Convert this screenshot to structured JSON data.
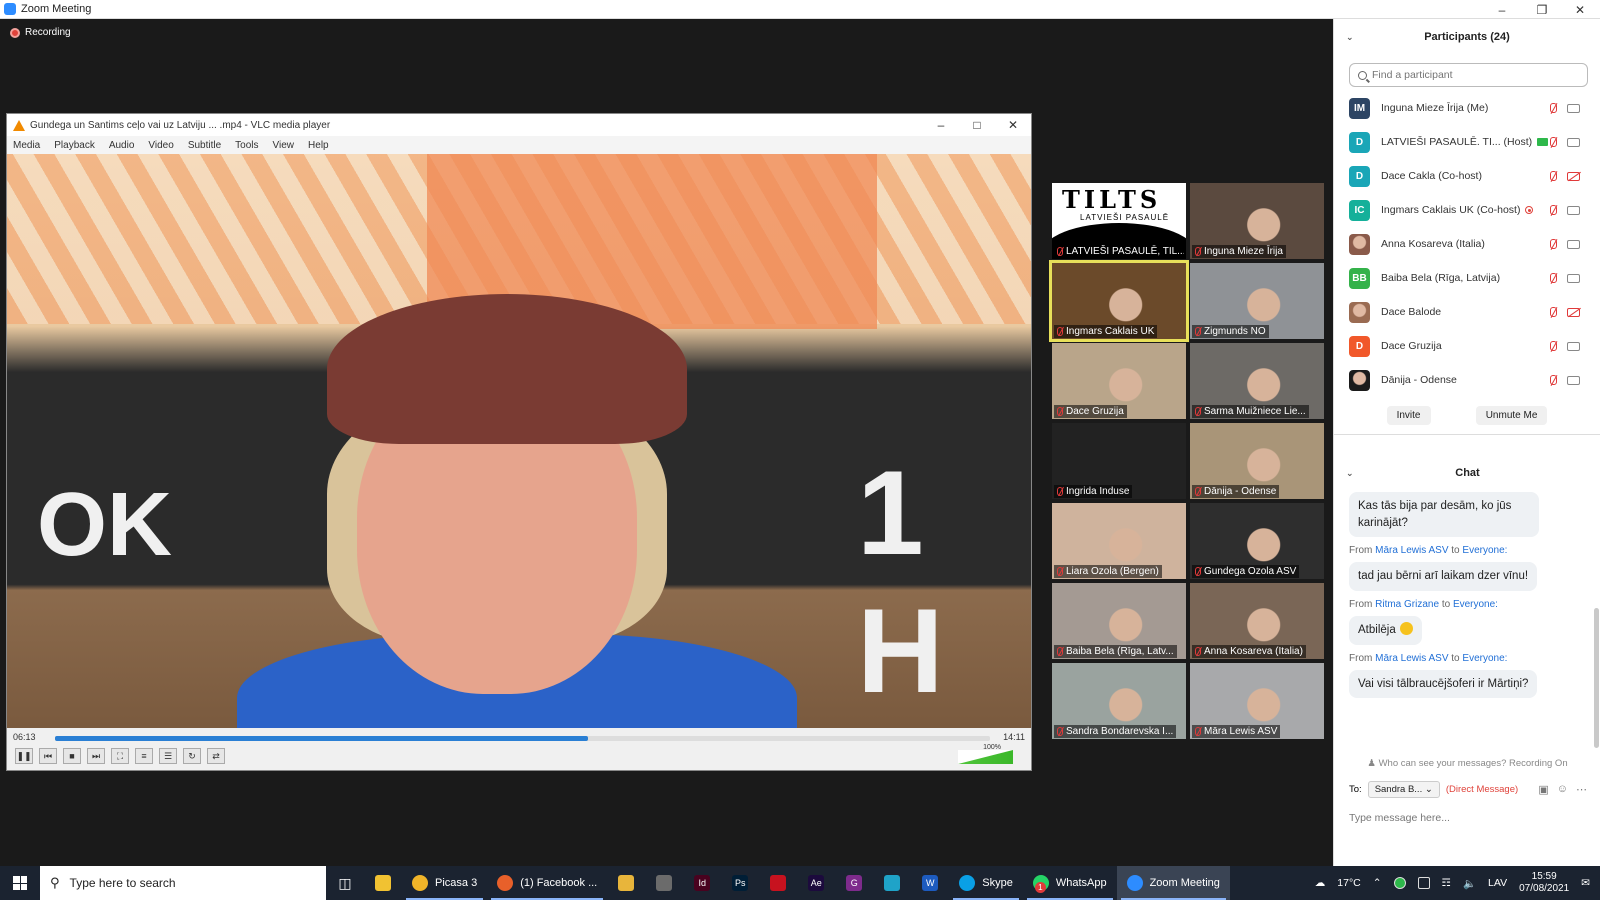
{
  "window": {
    "title": "Zoom Meeting"
  },
  "recording": {
    "label": "Recording"
  },
  "vlc": {
    "title": "Gundega un Santims ceļo vai uz Latviju ... .mp4 - VLC media player",
    "menu": [
      "Media",
      "Playback",
      "Audio",
      "Video",
      "Subtitle",
      "Tools",
      "View",
      "Help"
    ],
    "time_elapsed": "06:13",
    "time_total": "14:11",
    "progress": 0.57,
    "volume_label": "100%",
    "sign_left": "OK",
    "sign_right": "1 H"
  },
  "gallery": [
    {
      "name": "LATVIEŠI PASAULĒ, TIL...",
      "style": "tilts"
    },
    {
      "name": "Inguna Mieze Īrija",
      "color": "#5b4a3f"
    },
    {
      "name": "Ingmars Caklais UK",
      "color": "#6b4a2a",
      "active": true
    },
    {
      "name": "Zigmunds NO",
      "color": "#8f9296"
    },
    {
      "name": "Dace Gruzija",
      "color": "#b9a58a"
    },
    {
      "name": "Sarma Muižniece Lie...",
      "color": "#6d6a66"
    },
    {
      "name": "Ingrida Induse",
      "color": "#222222"
    },
    {
      "name": "Dānija - Odense",
      "color": "#a99578"
    },
    {
      "name": "Liara Ozola (Bergen)",
      "color": "#cfb39d"
    },
    {
      "name": "Gundega Ozola ASV",
      "color": "#2e2e2e"
    },
    {
      "name": "Baiba Bela (Rīga, Latv...",
      "color": "#a49a93"
    },
    {
      "name": "Anna Kosareva (Italia)",
      "color": "#7a6656"
    },
    {
      "name": "Sandra Bondarevska I...",
      "color": "#9aa39f"
    },
    {
      "name": "Māra Lewis ASV",
      "color": "#a8a9ab"
    }
  ],
  "tilts": {
    "title": "TILTS",
    "subtitle": "LATVIEŠI PASAULĒ"
  },
  "participants": {
    "header": "Participants (24)",
    "search_placeholder": "Find a participant",
    "list": [
      {
        "initials": "IM",
        "color": "#2d4564",
        "name": "Inguna Mieze Īrija (Me)",
        "cam_off": false
      },
      {
        "initials": "D",
        "color": "#1aa6b7",
        "name": "LATVIEŠI PASAULĒ. TI... (Host)",
        "share": true,
        "cam_off": false
      },
      {
        "initials": "D",
        "color": "#1aa6b7",
        "name": "Dace Cakla (Co-host)",
        "cam_off": true
      },
      {
        "initials": "IC",
        "color": "#15b09a",
        "name": "Ingmars Caklais UK (Co-host)",
        "rec": true,
        "cam_off": false
      },
      {
        "initials": "",
        "color": "#8a5a4a",
        "name": "Anna Kosareva (Italia)",
        "cam_off": false
      },
      {
        "initials": "BB",
        "color": "#34b24a",
        "name": "Baiba Bela (Rīga, Latvija)",
        "cam_off": false
      },
      {
        "initials": "",
        "color": "#9a6b52",
        "name": "Dace Balode",
        "cam_off": true
      },
      {
        "initials": "D",
        "color": "#f1582a",
        "name": "Dace Gruzija",
        "cam_off": false
      },
      {
        "initials": "",
        "color": "#1b1b1b",
        "name": "Dānija - Odense",
        "cam_off": false
      }
    ],
    "invite_label": "Invite",
    "unmute_label": "Unmute Me"
  },
  "chat": {
    "header": "Chat",
    "messages": [
      {
        "from": null,
        "text": "Kas tās bija par desām, ko jūs karinājāt?"
      },
      {
        "from": "Māra Lewis ASV",
        "to": "Everyone:",
        "text": "tad jau bērni arī laikam dzer vīnu!"
      },
      {
        "from": "Ritma Grizane",
        "to": "Everyone:",
        "text": "Atbilēja",
        "emoji": true
      },
      {
        "from": "Māra Lewis ASV",
        "to": "Everyone:",
        "text": "Vai visi tālbraucējšoferi ir Mārtiņi?"
      }
    ],
    "from_word": "From",
    "to_word": "to",
    "who_can_see": "Who can see your messages? Recording On",
    "to_label": "To:",
    "recipient": "Sandra B...",
    "direct_message": "(Direct Message)",
    "input_placeholder": "Type message here..."
  },
  "taskbar": {
    "search_placeholder": "Type here to search",
    "apps": [
      {
        "label": "Picasa 3",
        "color": "#f0b429"
      },
      {
        "label": "(1) Facebook ...",
        "color": "#e8602a"
      }
    ],
    "apps2": [
      {
        "label": "Skype",
        "color": "#0aa0e6"
      },
      {
        "label": "WhatsApp",
        "color": "#25d366",
        "badge": "1"
      },
      {
        "label": "Zoom Meeting",
        "color": "#2d8cff",
        "active": true
      }
    ],
    "icons": [
      {
        "name": "chrome",
        "color": "#e8b53b"
      },
      {
        "name": "store",
        "color": "#6b6b6b"
      },
      {
        "name": "indesign",
        "color": "#49021f",
        "text": "Id"
      },
      {
        "name": "photoshop",
        "color": "#001e36",
        "text": "Ps"
      },
      {
        "name": "acrobat",
        "color": "#c7121f",
        "text": ""
      },
      {
        "name": "after-effects",
        "color": "#1c0a3d",
        "text": "Ae"
      },
      {
        "name": "app-g",
        "color": "#7e2b8c",
        "text": "G"
      },
      {
        "name": "edge",
        "color": "#1fa3c8",
        "text": ""
      },
      {
        "name": "word",
        "color": "#1d5bbf",
        "text": "W"
      }
    ],
    "weather": "17°C",
    "lang": "LAV",
    "time": "15:59",
    "date": "07/08/2021"
  }
}
